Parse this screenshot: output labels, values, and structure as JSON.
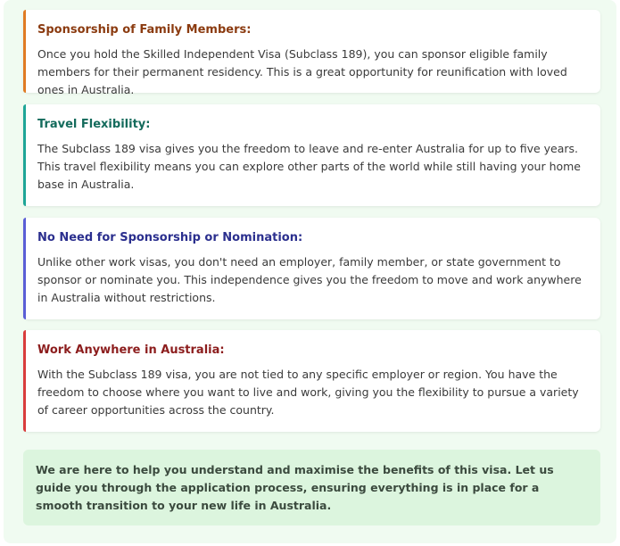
{
  "cards": [
    {
      "title": "Sponsorship of Family Members:",
      "body": "Once you hold the Skilled Independent Visa (Subclass 189), you can sponsor eligible family members for their permanent residency. This is a great opportunity for reunification with loved ones in Australia.",
      "accent_color": "#e07b24"
    },
    {
      "title": "Travel Flexibility:",
      "body": "The Subclass 189 visa gives you the freedom to leave and re-enter Australia for up to five years. This travel flexibility means you can explore other parts of the world while still having your home base in Australia.",
      "accent_color": "#1ea597"
    },
    {
      "title": "No Need for Sponsorship or Nomination:",
      "body": "Unlike other work visas, you don't need an employer, family member, or state government to sponsor or nominate you. This independence gives you the freedom to move and work anywhere in Australia without restrictions.",
      "accent_color": "#5a5ed6"
    },
    {
      "title": "Work Anywhere in Australia:",
      "body": "With the Subclass 189 visa, you are not tied to any specific employer or region. You have the freedom to choose where you want to live and work, giving you the flexibility to pursue a variety of career opportunities across the country.",
      "accent_color": "#d93c3c"
    }
  ],
  "note": {
    "text": "We are here to help you understand and maximise the benefits of this visa. Let us guide you through the application process, ensuring everything is in place for a smooth transition to your new life in Australia."
  }
}
